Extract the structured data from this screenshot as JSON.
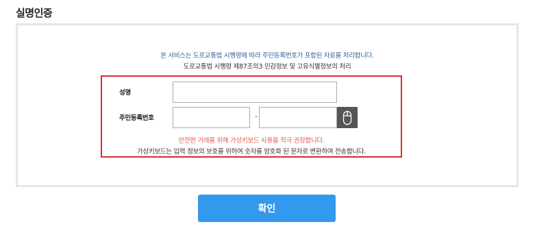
{
  "page": {
    "title": "실명인증"
  },
  "notice": {
    "line1": "본 서비스는 도로교통법 시행령에 따라 주민등록번호가 포함된 자료를 처리합니다.",
    "line2": "도로교통법 시행령 제87조의3 민감정보 및 고유식별정보의 처리"
  },
  "form": {
    "name_label": "성명",
    "name_value": "",
    "rrn_label": "주민등록번호",
    "rrn_first_value": "",
    "rrn_separator": "-",
    "rrn_second_value": "",
    "virtual_keyboard_icon": "mouse-icon",
    "warning_red": "안전한 거래를 위해 가상키보드 사용을 적극 권장합니다.",
    "warning_info": "가상키보드는 입력 정보의 보호를 위하여 숫자를 암호화 된 문자로 변환하여 전송합니다."
  },
  "actions": {
    "confirm_label": "확인"
  },
  "colors": {
    "notice_blue": "#2f5f9f",
    "form_border_red": "#d92b2b",
    "warning_red": "#e05a4a",
    "confirm_button": "#3399ee",
    "virtual_keyboard_button": "#555555"
  }
}
